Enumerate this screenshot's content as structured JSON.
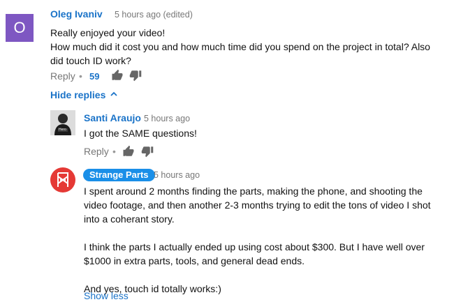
{
  "comment": {
    "avatar_letter": "O",
    "author": "Oleg Ivaniv",
    "time": "5 hours ago (edited)",
    "lines": [
      "Really enjoyed your video!",
      "How much did it cost you and how much time did you spend on the project in total? Also",
      "did touch ID work?"
    ],
    "reply_label": "Reply",
    "separator": "•",
    "like_count": "59",
    "hide_replies_label": "Hide replies"
  },
  "replies": [
    {
      "author": "Santi Araujo",
      "time": "5 hours ago",
      "lines": [
        "I got the SAME questions!"
      ],
      "reply_label": "Reply",
      "separator": "•",
      "avatar_text": "Hero"
    },
    {
      "author": "Strange Parts",
      "time": "5 hours ago",
      "lines": [
        "I spent around 2 months finding the parts, making the phone, and shooting the",
        "video footage, and then another 2-3 months trying to edit the tons of video I shot",
        "into a coherant story.",
        "",
        "I think the parts I actually ended up using cost about $300. But I have well over",
        "$1000 in extra parts, tools, and general dead ends.",
        "",
        "And yes, touch id totally works:)"
      ],
      "show_less_label": "Show less"
    }
  ],
  "colors": {
    "author_blue": "#1a73c8",
    "badge_blue": "#1a8fe8",
    "avatar_purple": "#7e57c2",
    "logo_red": "#e53935"
  }
}
